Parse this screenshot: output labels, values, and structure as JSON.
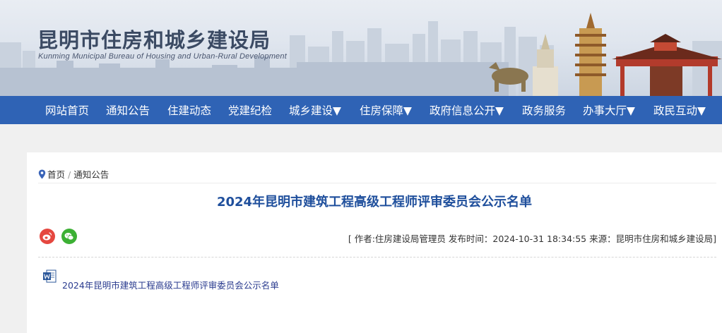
{
  "site": {
    "title": "昆明市住房和城乡建设局",
    "subtitle": "Kunming Municipal Bureau of Housing and Urban-Rural Development"
  },
  "nav": {
    "items": [
      {
        "label": "网站首页"
      },
      {
        "label": "通知公告"
      },
      {
        "label": "住建动态"
      },
      {
        "label": "党建纪检"
      },
      {
        "label": "城乡建设▼"
      },
      {
        "label": "住房保障▼"
      },
      {
        "label": "政府信息公开▼"
      },
      {
        "label": "政务服务"
      },
      {
        "label": "办事大厅▼"
      },
      {
        "label": "政民互动▼"
      }
    ]
  },
  "breadcrumb": {
    "home": "首页",
    "separator": "/",
    "current": "通知公告"
  },
  "article": {
    "title": "2024年昆明市建筑工程高级工程师评审委员会公示名单",
    "meta": "[ 作者:住房建设局管理员   发布时间：2024-10-31 18:34:55   来源：昆明市住房和城乡建设局]",
    "attachment": "2024年昆明市建筑工程高级工程师评审委员会公示名单"
  },
  "share": {
    "icons": [
      "weibo-icon",
      "wechat-icon"
    ]
  },
  "colors": {
    "nav_bg": "#2f63b5",
    "title_blue": "#1f4f9c",
    "weibo_red": "#e5473f",
    "wechat_green": "#3cb034"
  }
}
